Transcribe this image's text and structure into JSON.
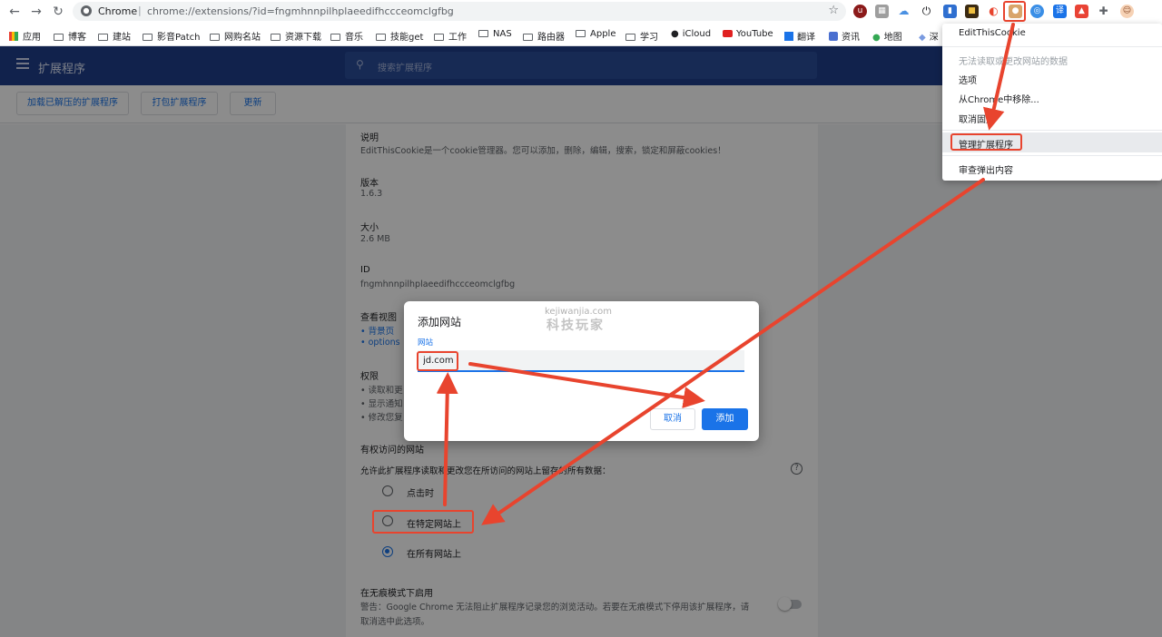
{
  "browser": {
    "back_icon": "arrow-left-icon",
    "forward_icon": "arrow-right-icon",
    "reload_icon": "reload-icon",
    "omnibox_site": "Chrome",
    "omnibox_separator": "|",
    "omnibox_url": "chrome://extensions/?id=fngmhnnpilhplaeedifhccceomclgfbg",
    "bookmark_star_icon": "star-icon",
    "extension_icons": [
      "ublock-icon",
      "tabs-icon",
      "cloud-icon",
      "power-icon",
      "bookmark-icon",
      "film-icon",
      "palette-icon",
      "cookie-icon",
      "search-ext-icon",
      "translate-icon",
      "ext-icon",
      "puzzle-icon",
      "avatar-icon"
    ]
  },
  "bookmarks": [
    "应用",
    "博客",
    "建站",
    "影音Patch",
    "网购名站",
    "资源下载",
    "音乐",
    "技能get",
    "工作",
    "NAS",
    "路由器",
    "Apple",
    "学习",
    "iCloud",
    "YouTube",
    "翻译",
    "资讯",
    "地图",
    "深"
  ],
  "extensions_page": {
    "header_title": "扩展程序",
    "search_placeholder": "搜索扩展程序",
    "toolbar": {
      "load_unpacked": "加载已解压的扩展程序",
      "pack": "打包扩展程序",
      "update": "更新"
    },
    "details": {
      "description_label": "说明",
      "description_value": "EditThisCookie是一个cookie管理器。您可以添加，删除，编辑，搜索，锁定和屏蔽cookies！",
      "version_label": "版本",
      "version_value": "1.6.3",
      "size_label": "大小",
      "size_value": "2.6 MB",
      "id_label": "ID",
      "id_value": "fngmhnnpilhplaeedifhccceomclgfbg",
      "views_label": "查看视图",
      "views": [
        "背景页",
        "options"
      ],
      "permissions_label": "权限",
      "permissions": [
        "读取和更",
        "显示通知",
        "修改您复"
      ],
      "site_access_label": "有权访问的网站",
      "site_access_desc": "允许此扩展程序读取和更改您在所访问的网站上留存的所有数据：",
      "site_options": [
        {
          "label": "点击时",
          "selected": false
        },
        {
          "label": "在特定网站上",
          "selected": false
        },
        {
          "label": "在所有网站上",
          "selected": true
        }
      ],
      "incognito_label": "在无痕模式下启用",
      "incognito_warning_1": "警告：Google Chrome 无法阻止扩展程序记录您的浏览活动。若要在无痕模式下停用该扩展程序，请",
      "incognito_warning_2": "取消选中此选项。"
    }
  },
  "dialog": {
    "title": "添加网站",
    "field_label": "网站",
    "input_value": "jd.com",
    "cancel": "取消",
    "add": "添加",
    "watermark_en": "kejiwanjia.com",
    "watermark_cn": "科技玩家"
  },
  "context_menu": {
    "items": [
      {
        "label": "EditThisCookie",
        "disabled": false
      },
      {
        "label": "无法读取或更改网站的数据",
        "disabled": true
      },
      {
        "label": "选项",
        "disabled": false
      },
      {
        "label": "从Chrome中移除...",
        "disabled": false
      },
      {
        "label": "取消固定",
        "disabled": false
      },
      {
        "label": "管理扩展程序",
        "disabled": false
      },
      {
        "label": "审查弹出内容",
        "disabled": false
      }
    ]
  },
  "colors": {
    "header_bg": "#1f3f8a",
    "accent": "#1a73e8",
    "annotation_red": "#e8442e"
  }
}
